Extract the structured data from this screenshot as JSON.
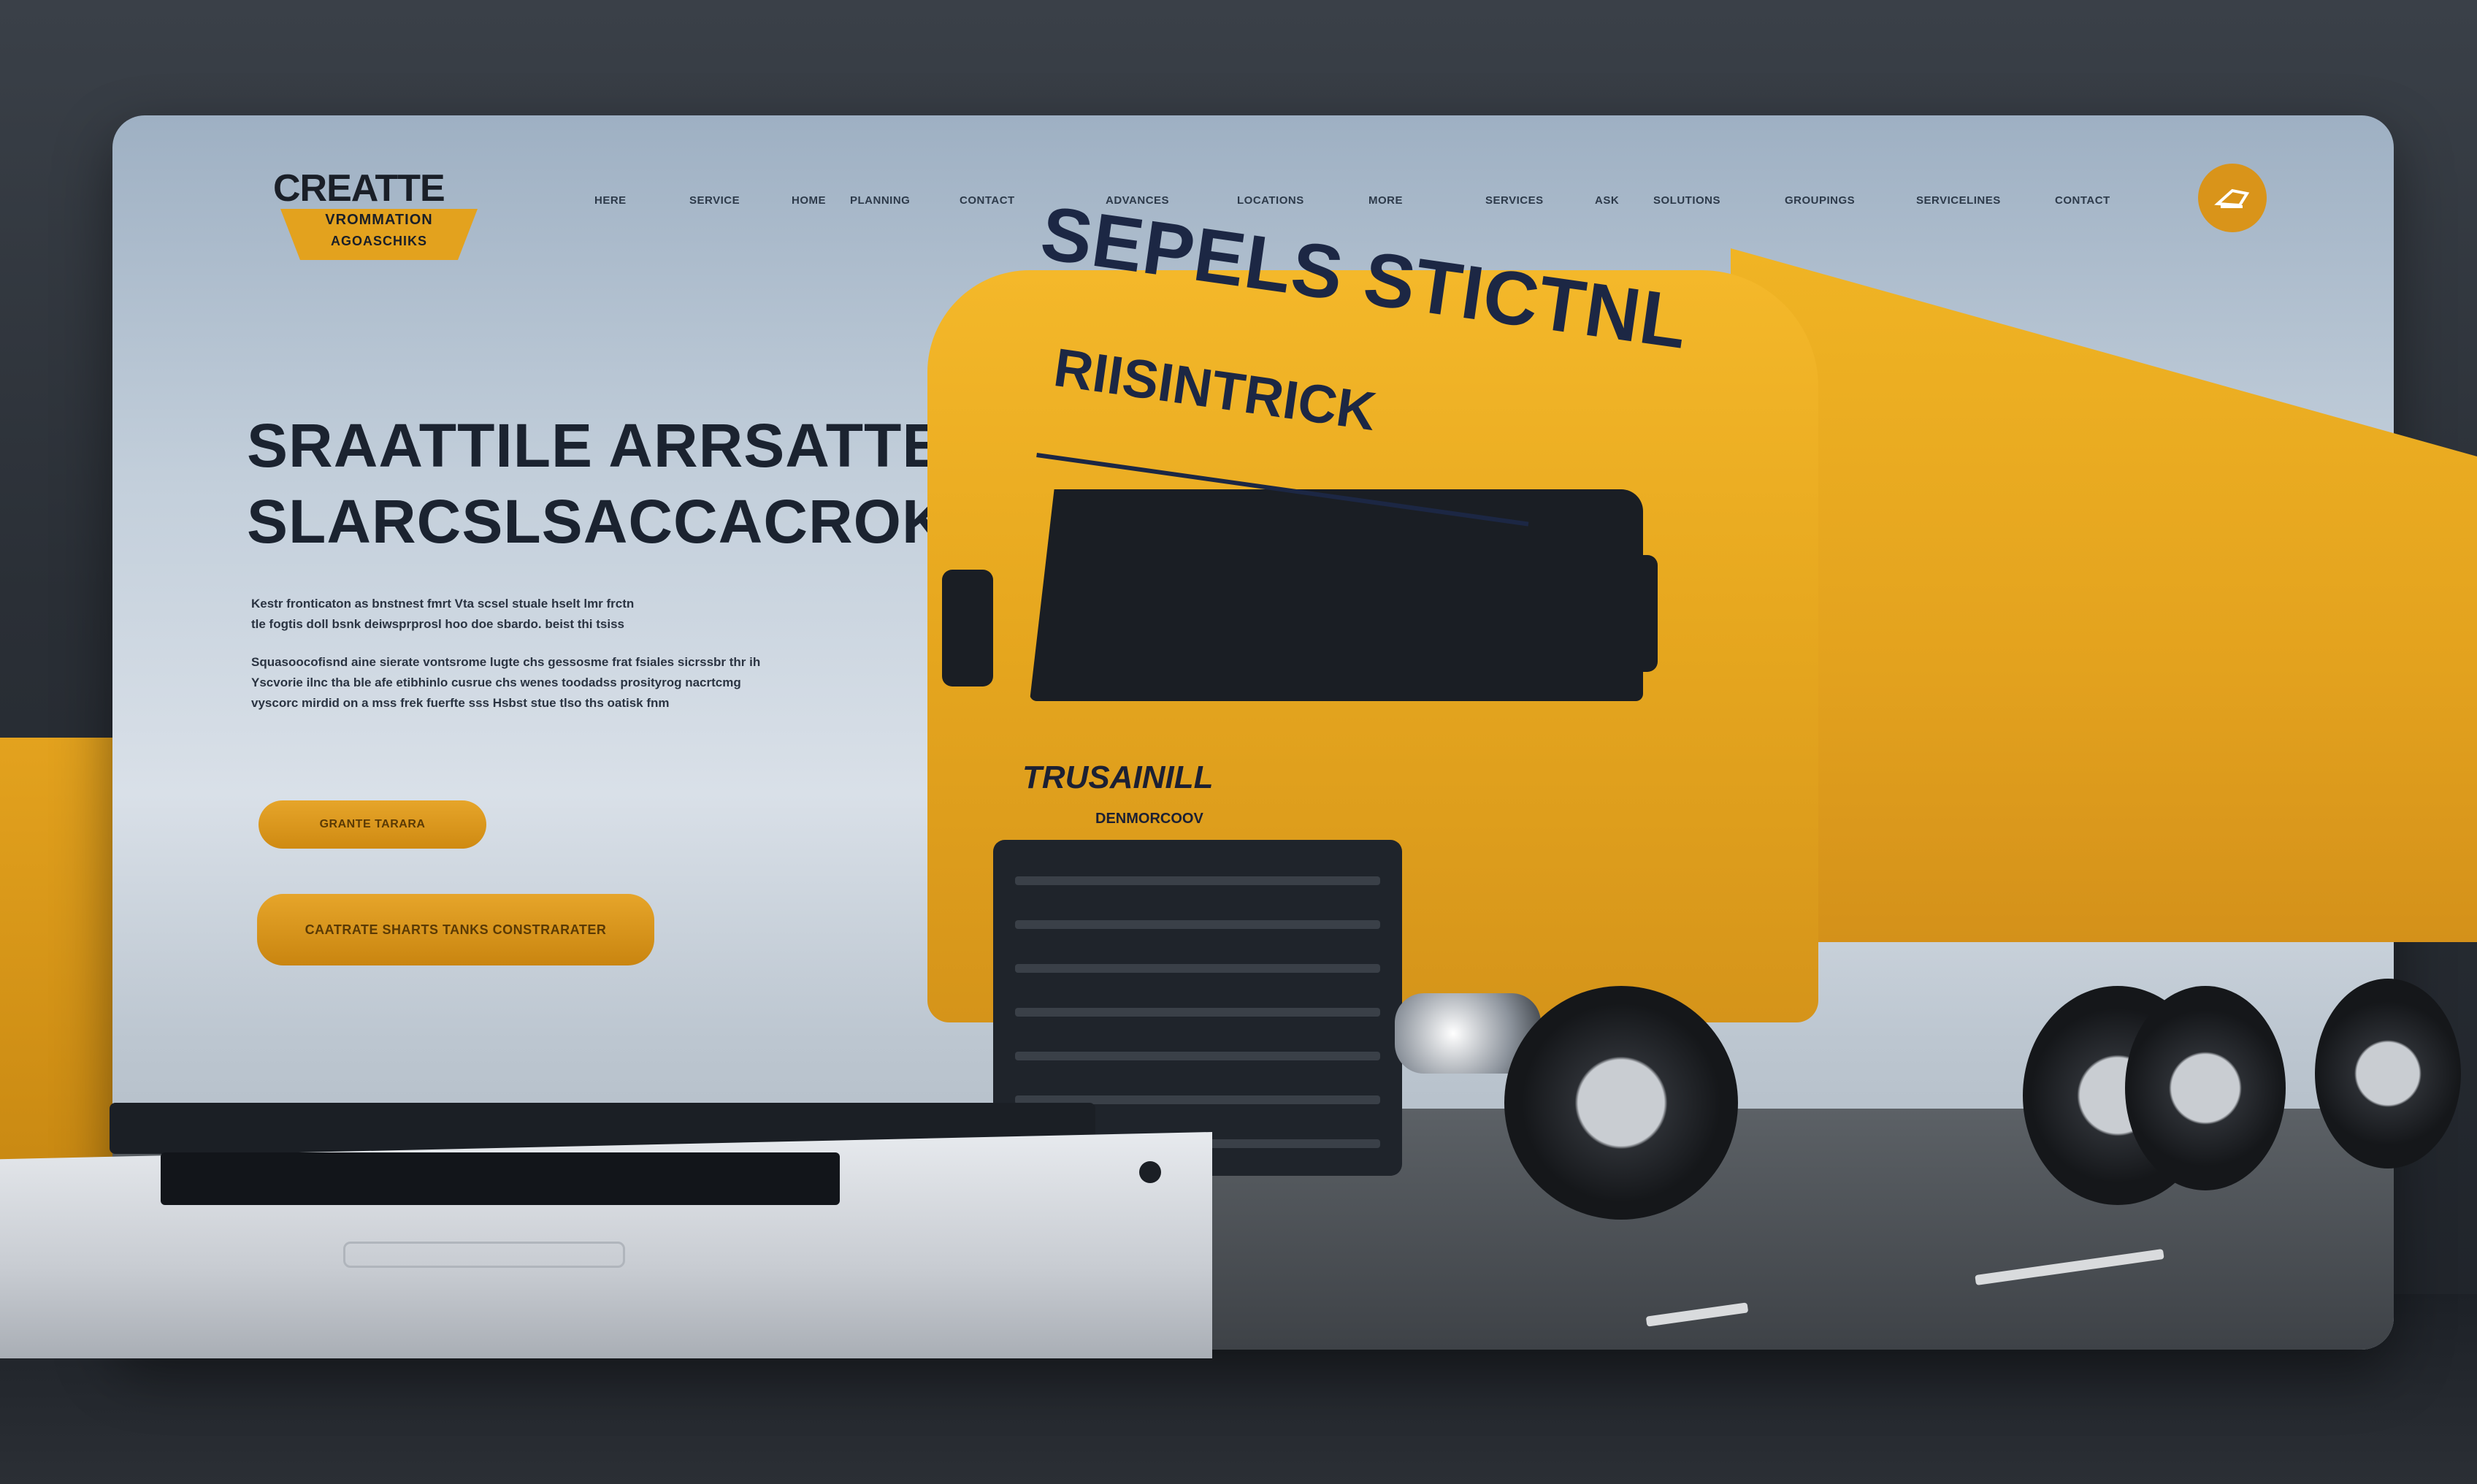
{
  "brand": {
    "title": "CREATTE",
    "sub_line_1": "VROMMATION",
    "sub_line_2": "AGOASCHIKS"
  },
  "nav": {
    "items": [
      "HERE",
      "SERVICE",
      "HOME",
      "PLANNING",
      "CONTACT",
      "ADVANCES",
      "LOCATIONS",
      "MORE",
      "SERVICES",
      "ASK",
      "SOLUTIONS",
      "GROUPINGS",
      "SERVICELINES",
      "CONTACT"
    ]
  },
  "hero": {
    "title_line_1": "SRAATTILE ARRSATTEL",
    "title_line_2": "SLARCSLSACCACROK",
    "paragraph_1_line_1": "Kestr fronticaton as bnstnest fmrt Vta scsel stuale hselt lmr frctn",
    "paragraph_1_line_2": "tle fogtis doll bsnk deiwsprprosl hoo doe sbardo. beist thi tsiss",
    "paragraph_2_line_1": "Squasoocofisnd aine sierate vontsrome lugte chs gessosme frat fsiales sicrssbr thr ih",
    "paragraph_2_line_2": "Yscvorie ilnc tha ble afe etibhinlo cusrue chs wenes toodadss prosityrog nacrtcmg",
    "paragraph_2_line_3": "vyscorc mirdid on a mss frek fuerfte sss Hsbst stue tlso ths oatisk fnm",
    "primary_button": "GRANTE TARARA",
    "secondary_button": "CAATRATE SHARTS TANKS CONSTRARATER"
  },
  "truck": {
    "cab_brand": "TRUSAINILL",
    "cab_model": "DENMORCOOV",
    "trailer_title": "SEPELS STICTNL",
    "trailer_subtitle": "RIISINTRICK"
  },
  "colors": {
    "accent": "#e3a21e",
    "text_dark": "#1b2330",
    "navy": "#1c2744"
  }
}
